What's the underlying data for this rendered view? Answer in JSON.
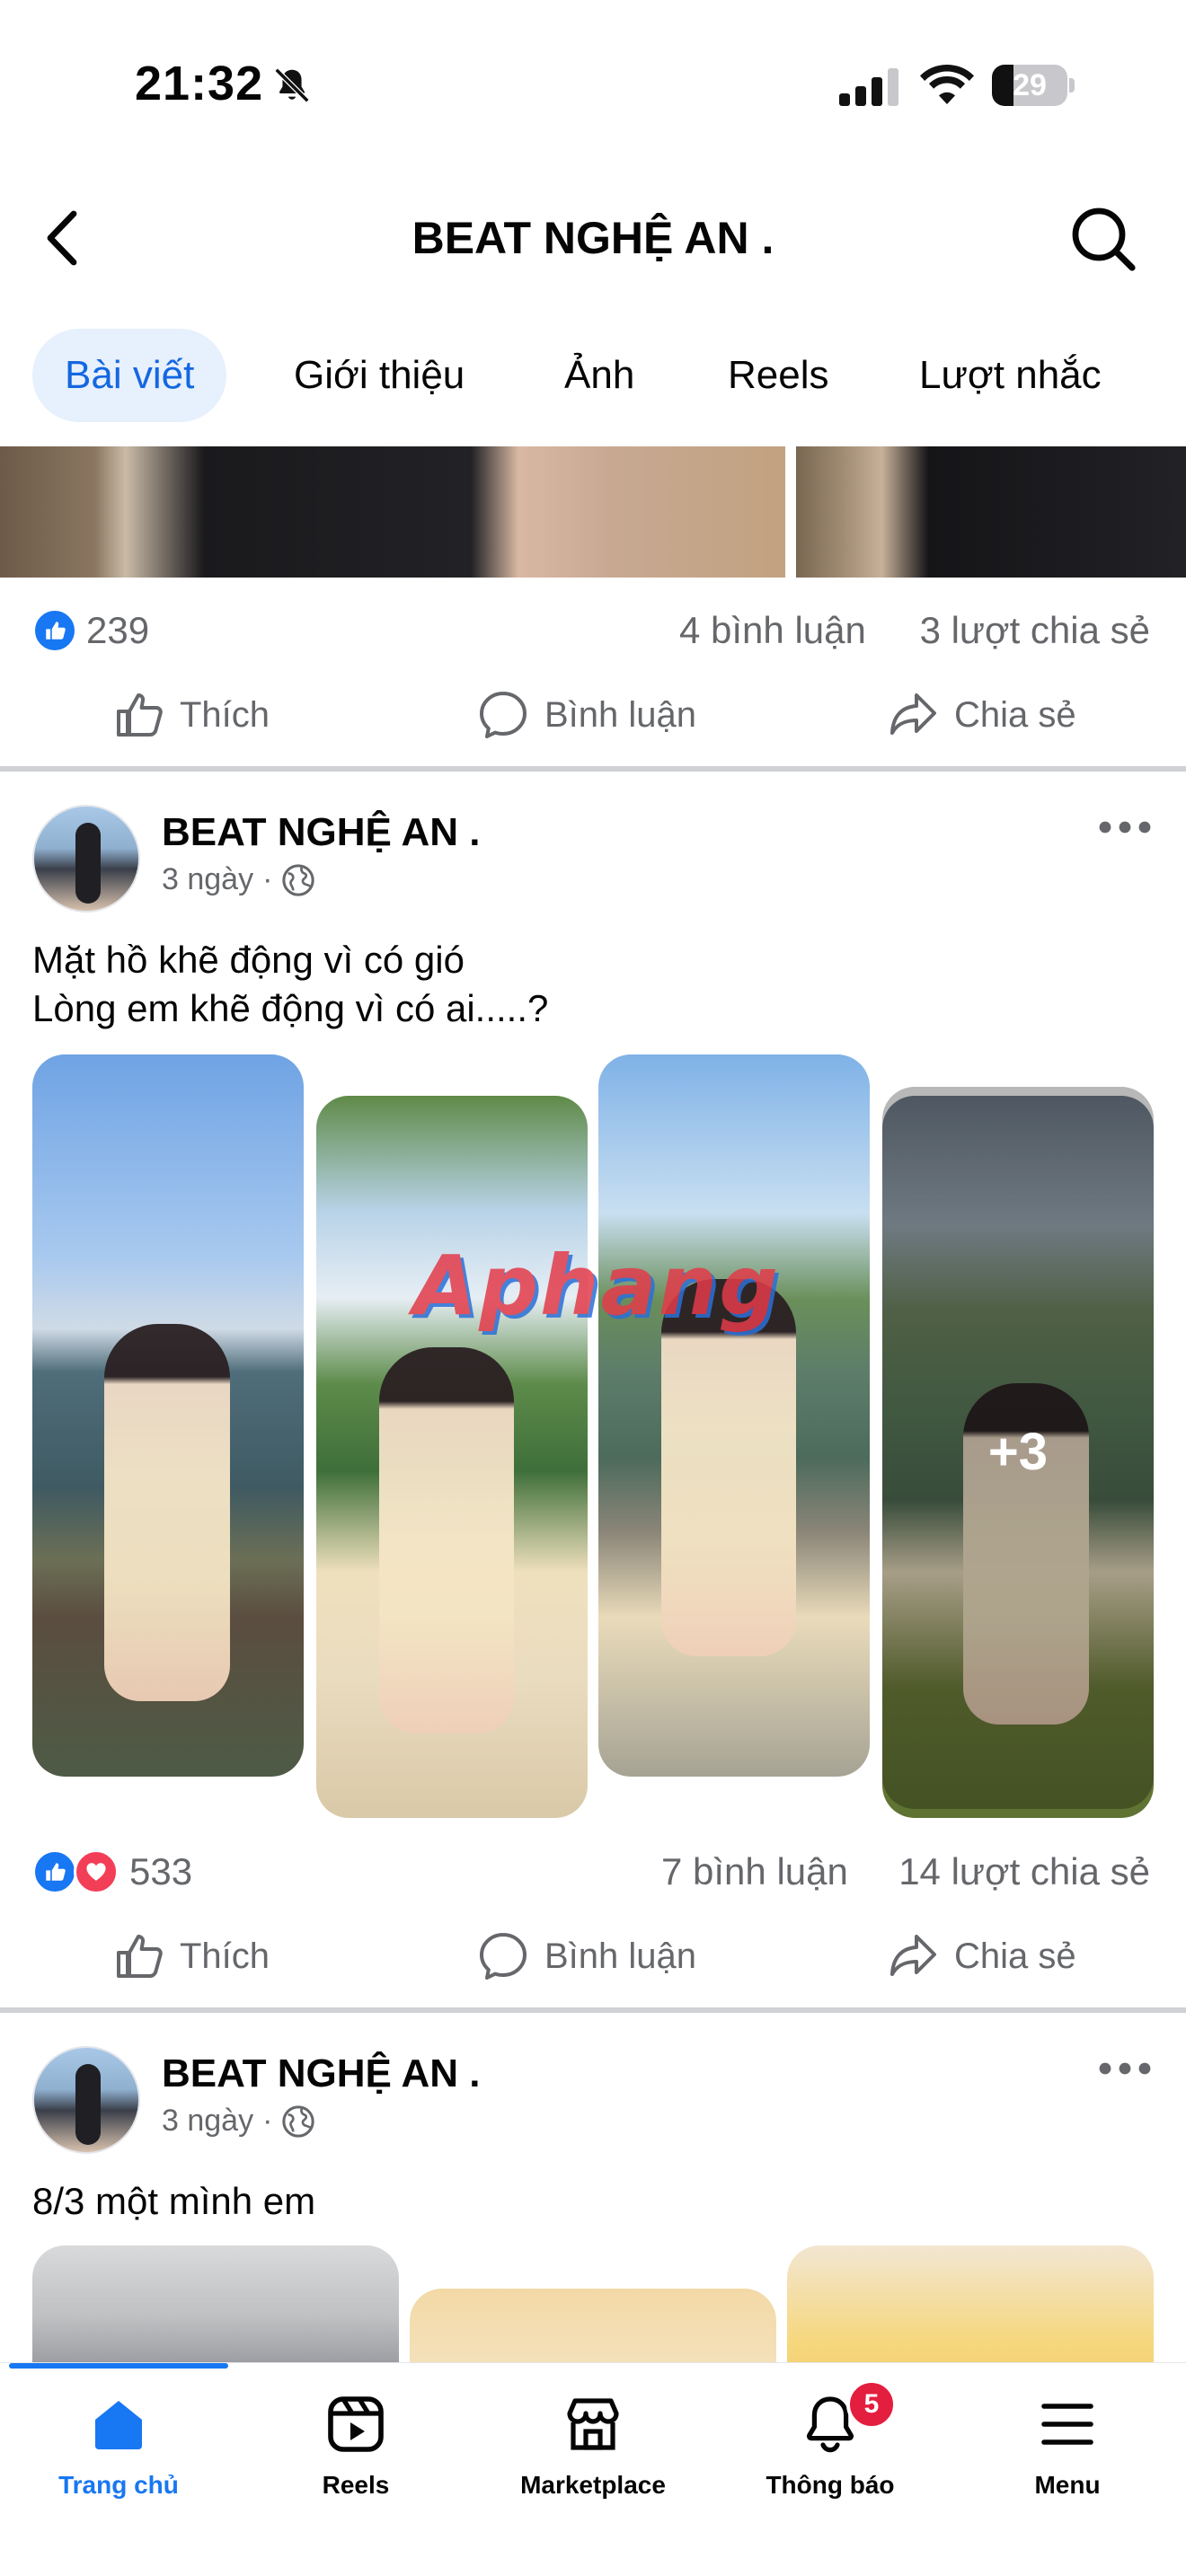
{
  "status_bar": {
    "time": "21:32",
    "battery_level": "29",
    "battery_fraction": 0.29
  },
  "header": {
    "title": "BEAT NGHỆ AN .",
    "back_icon": "chevron-left-icon",
    "search_icon": "search-icon"
  },
  "tabs": [
    {
      "label": "Bài viết",
      "active": true
    },
    {
      "label": "Giới thiệu",
      "active": false
    },
    {
      "label": "Ảnh",
      "active": false
    },
    {
      "label": "Reels",
      "active": false
    },
    {
      "label": "Lượt nhắc",
      "active": false
    }
  ],
  "post_prev": {
    "reactions": "239",
    "comments": "4 bình luận",
    "shares": "3 lượt chia sẻ"
  },
  "actions": {
    "like": "Thích",
    "comment": "Bình luận",
    "share": "Chia sẻ"
  },
  "post_main": {
    "author": "BEAT NGHỆ AN .",
    "time": "3 ngày",
    "separator": "·",
    "text_line1": "Mặt hồ khẽ động vì có gió",
    "text_line2": "Lòng em khẽ động vì có ai.....?",
    "more_photos": "+3",
    "watermark": "Aphang",
    "reactions": "533",
    "comments": "7 bình luận",
    "shares": "14 lượt chia sẻ"
  },
  "post_next": {
    "author": "BEAT NGHỆ AN .",
    "time": "3 ngày",
    "separator": "·",
    "text": "8/3  một mình em"
  },
  "bottom_nav": [
    {
      "label": "Trang chủ",
      "icon": "home-icon",
      "active": true
    },
    {
      "label": "Reels",
      "icon": "reels-icon",
      "active": false
    },
    {
      "label": "Marketplace",
      "icon": "marketplace-icon",
      "active": false
    },
    {
      "label": "Thông báo",
      "icon": "bell-icon",
      "active": false,
      "badge": "5"
    },
    {
      "label": "Menu",
      "icon": "menu-icon",
      "active": false
    }
  ],
  "colors": {
    "accent": "#1877f2",
    "text_secondary": "#65676b",
    "love": "#f33e58",
    "badge": "#e41e3f"
  }
}
